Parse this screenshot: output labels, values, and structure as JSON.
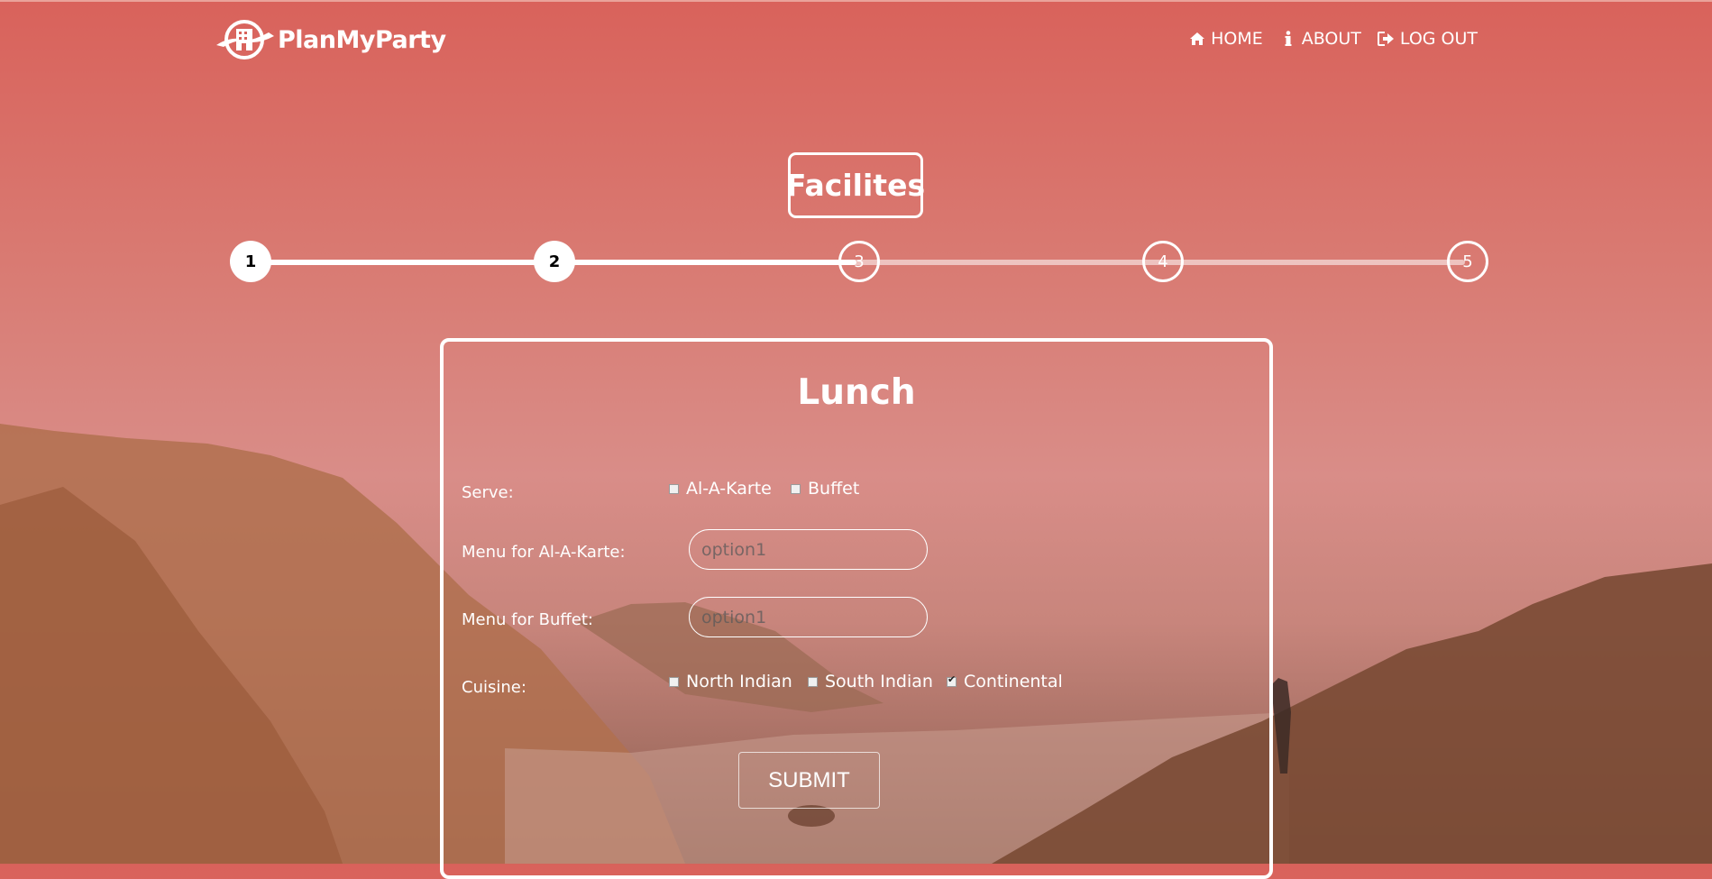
{
  "app": {
    "name": "PlanMyParty",
    "logo_icon": "building-logo-icon"
  },
  "nav": {
    "home": {
      "label": "HOME",
      "icon": "home-icon"
    },
    "about": {
      "label": "ABOUT",
      "icon": "info-icon"
    },
    "logout": {
      "label": "LOG OUT",
      "icon": "logout-icon"
    }
  },
  "wizard": {
    "title": "Facilites",
    "steps": [
      "1",
      "2",
      "3",
      "4",
      "5"
    ],
    "completed_steps": 2
  },
  "form": {
    "title": "Lunch",
    "serve": {
      "label": "Serve:",
      "options": [
        {
          "label": "Al-A-Karte",
          "checked": false
        },
        {
          "label": "Buffet",
          "checked": false
        }
      ]
    },
    "menu_alacarte": {
      "label": "Menu for Al-A-Karte:",
      "placeholder": "option1"
    },
    "menu_buffet": {
      "label": "Menu for Buffet:",
      "placeholder": "option1"
    },
    "cuisine": {
      "label": "Cuisine:",
      "options": [
        {
          "label": "North Indian",
          "checked": false
        },
        {
          "label": "South Indian",
          "checked": false
        },
        {
          "label": "Continental",
          "checked": true
        }
      ]
    },
    "submit_label": "SUBMIT"
  },
  "colors": {
    "background_top": "#d9625b",
    "background_mid": "#d98d88",
    "foreground": "#ffffff"
  }
}
